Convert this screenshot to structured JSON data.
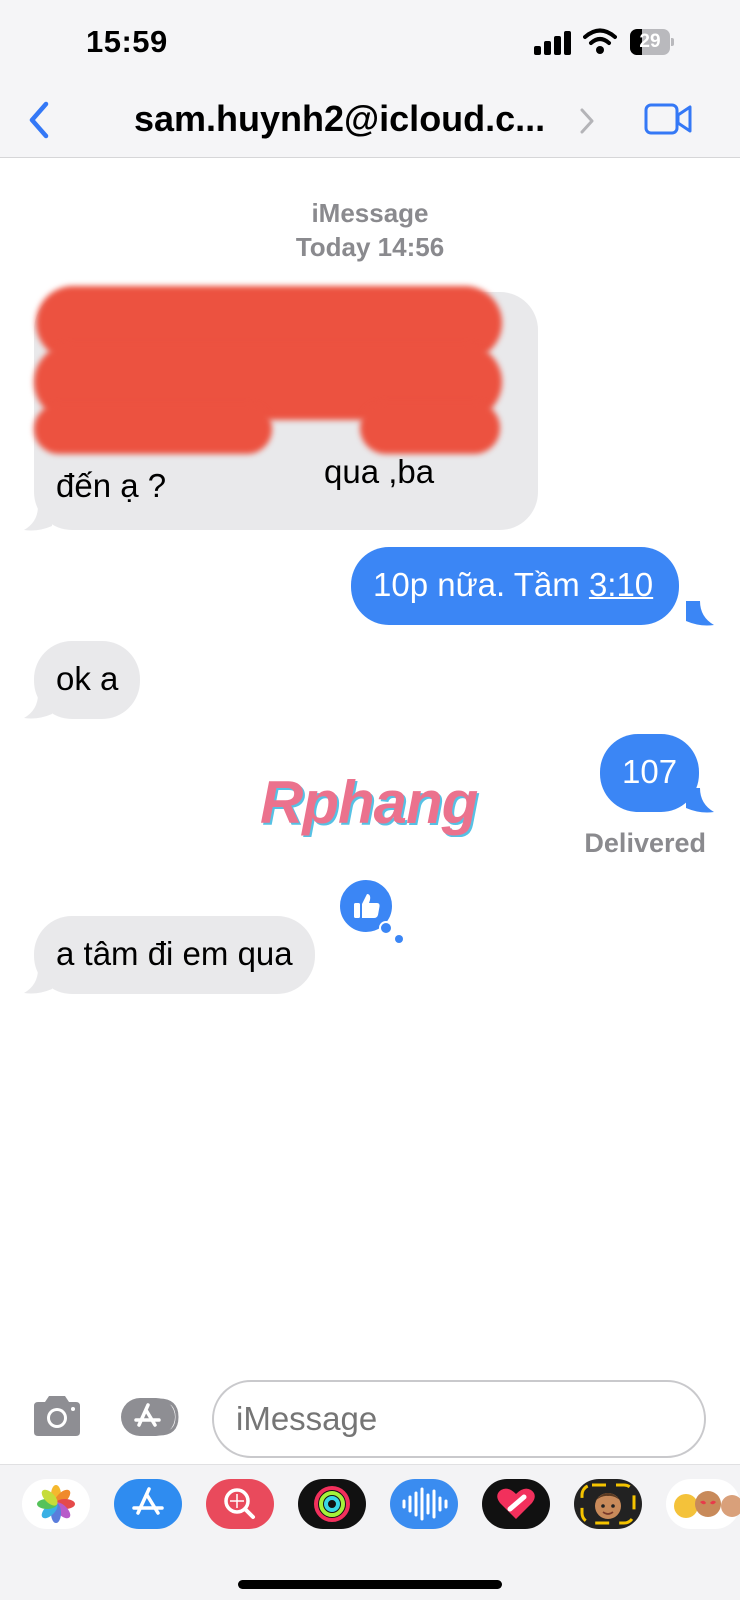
{
  "status_bar": {
    "time": "15:59",
    "battery": "29",
    "battery_level": 0.29
  },
  "nav": {
    "contact": "sam.huynh2@icloud.c..."
  },
  "conversation": {
    "service": "iMessage",
    "timestamp": "Today 14:56",
    "messages": [
      {
        "from": "them",
        "text_visible_fragment": "qua ,ba",
        "last_line": "đến ạ ?"
      },
      {
        "from": "me",
        "text": "10p nữa. Tầm ",
        "link": "3:10"
      },
      {
        "from": "them",
        "text": "ok a"
      },
      {
        "from": "me",
        "text": "107",
        "status": "Delivered"
      },
      {
        "from": "them",
        "text": "a tâm đi em qua",
        "reaction": "thumbs-up"
      }
    ]
  },
  "watermark": "Rphang",
  "input": {
    "placeholder": "iMessage"
  },
  "drawer_apps": [
    "photos",
    "app-store",
    "image-search",
    "activity",
    "audio-message",
    "digital-touch",
    "memoji",
    "memoji-stickers"
  ],
  "colors": {
    "sent_bubble": "#3b86f5",
    "received_bubble": "#e9e9eb",
    "accent": "#3478f6",
    "redaction": "#ec5240"
  }
}
